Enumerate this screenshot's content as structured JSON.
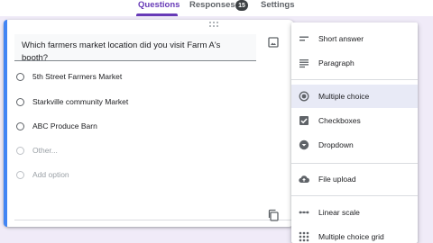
{
  "tabs": [
    {
      "label": "Questions",
      "active": true
    },
    {
      "label": "Responses",
      "active": false,
      "badge": "15"
    },
    {
      "label": "Settings",
      "active": false
    }
  ],
  "question": {
    "title": "Which farmers market location did you visit Farm A's booth?",
    "options": [
      "5th Street Farmers Market",
      "Starkville community Market",
      "ABC Produce Barn"
    ],
    "other_option": "Other...",
    "add_option": "Add option"
  },
  "type_menu": {
    "items": [
      {
        "label": "Short answer",
        "icon": "short-answer-icon"
      },
      {
        "label": "Paragraph",
        "icon": "paragraph-icon"
      },
      {
        "label": "Multiple choice",
        "icon": "radio-button-icon",
        "selected": true
      },
      {
        "label": "Checkboxes",
        "icon": "checkbox-icon"
      },
      {
        "label": "Dropdown",
        "icon": "dropdown-icon"
      },
      {
        "label": "File upload",
        "icon": "cloud-upload-icon"
      },
      {
        "label": "Linear scale",
        "icon": "linear-scale-icon"
      },
      {
        "label": "Multiple choice grid",
        "icon": "grid-icon"
      }
    ]
  },
  "colors": {
    "accent": "#673ab7",
    "card_active_border": "#4285f4",
    "selected_item_bg": "#e8eaf6"
  }
}
